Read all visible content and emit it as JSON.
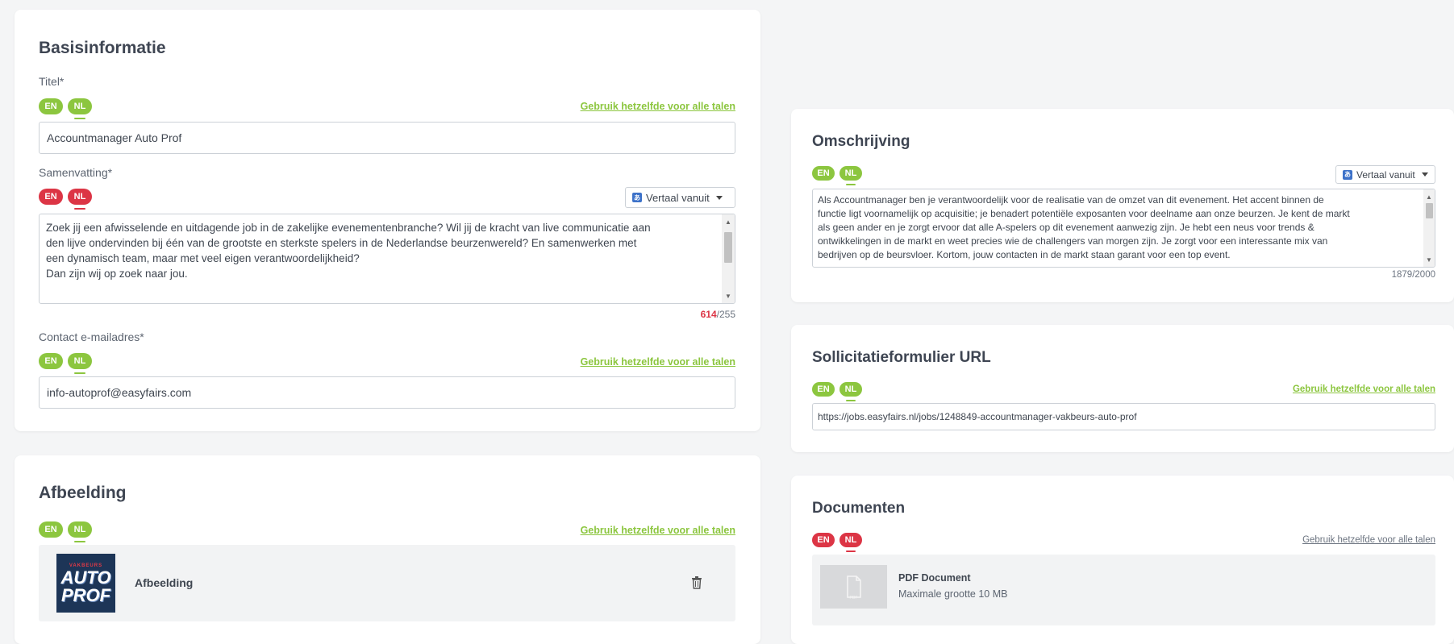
{
  "basis": {
    "title": "Basisinformatie",
    "titel_label": "Titel*",
    "titel_langs": [
      "EN",
      "NL"
    ],
    "same_link": "Gebruik hetzelfde voor alle talen",
    "titel_value": "Accountmanager Auto Prof",
    "samenvatting_label": "Samenvatting*",
    "samenvatting_langs": [
      "EN",
      "NL"
    ],
    "translate_label": "Vertaal vanuit",
    "samenvatting_text": "Zoek jij een afwisselende en uitdagende job in de zakelijke evenementenbranche? Wil jij de kracht van live communicatie aan\nden lijve ondervinden bij één van de grootste en sterkste spelers in de Nederlandse beurzenwereld? En samenwerken met\neen dynamisch team, maar met veel eigen verantwoordelijkheid?\nDan zijn wij op zoek naar jou.",
    "samenvatting_count": "614",
    "samenvatting_max": "/255",
    "contact_label": "Contact e-mailadres*",
    "contact_langs": [
      "EN",
      "NL"
    ],
    "contact_value": "info-autoprof@easyfairs.com"
  },
  "afbeelding": {
    "title": "Afbeelding",
    "langs": [
      "EN",
      "NL"
    ],
    "same_link": "Gebruik hetzelfde voor alle talen",
    "logo_top": "VAKBEURS",
    "logo_line1": "AUTO",
    "logo_line2": "PROF",
    "image_label": "Afbeelding",
    "trash_icon": "trash-icon"
  },
  "omschrijving": {
    "title": "Omschrijving",
    "langs": [
      "EN",
      "NL"
    ],
    "translate_label": "Vertaal vanuit",
    "text": "Als Accountmanager ben je verantwoordelijk voor de realisatie van de omzet van dit evenement. Het accent binnen de\nfunctie ligt voornamelijk op acquisitie; je benadert potentiële exposanten voor deelname aan onze beurzen. Je kent de markt\nals geen ander en je zorgt ervoor dat alle A-spelers op dit evenement aanwezig zijn. Je hebt een neus voor trends &\nontwikkelingen in de markt en weet precies wie de challengers van morgen zijn. Je zorgt voor een interessante mix van\nbedrijven op de beursvloer. Kortom, jouw contacten in de markt staan garant voor een top event.",
    "counter": "1879/2000"
  },
  "sollicitatie": {
    "title": "Sollicitatieformulier URL",
    "langs": [
      "EN",
      "NL"
    ],
    "same_link": "Gebruik hetzelfde voor alle talen",
    "url": "https://jobs.easyfairs.nl/jobs/1248849-accountmanager-vakbeurs-auto-prof"
  },
  "documenten": {
    "title": "Documenten",
    "langs": [
      "EN",
      "NL"
    ],
    "same_link": "Gebruik hetzelfde voor alle talen",
    "doc_title": "PDF Document",
    "doc_sub": "Maximale grootte 10 MB",
    "thumb_label": "PDF"
  },
  "colors": {
    "valid": "#8cc63f",
    "invalid": "#dc3545"
  }
}
